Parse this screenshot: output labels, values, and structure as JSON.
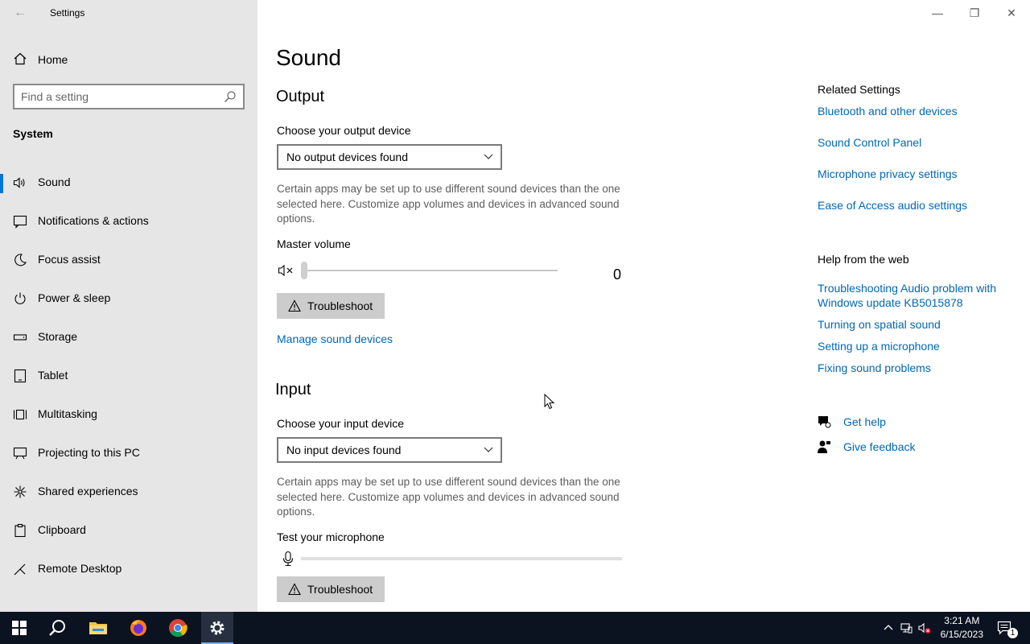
{
  "window": {
    "title": "Settings",
    "back_glyph": "←",
    "controls": {
      "minimize": "—",
      "maximize": "❐",
      "close": "✕"
    }
  },
  "sidebar": {
    "home_label": "Home",
    "search_placeholder": "Find a setting",
    "section": "System",
    "items": [
      {
        "label": "Sound",
        "icon": "speaker-icon",
        "active": true
      },
      {
        "label": "Notifications & actions",
        "icon": "notification-icon"
      },
      {
        "label": "Focus assist",
        "icon": "moon-icon"
      },
      {
        "label": "Power & sleep",
        "icon": "power-icon"
      },
      {
        "label": "Storage",
        "icon": "storage-icon"
      },
      {
        "label": "Tablet",
        "icon": "tablet-icon"
      },
      {
        "label": "Multitasking",
        "icon": "multitasking-icon"
      },
      {
        "label": "Projecting to this PC",
        "icon": "projector-icon"
      },
      {
        "label": "Shared experiences",
        "icon": "share-icon"
      },
      {
        "label": "Clipboard",
        "icon": "clipboard-icon"
      },
      {
        "label": "Remote Desktop",
        "icon": "remote-icon"
      }
    ]
  },
  "main": {
    "title": "Sound",
    "output": {
      "heading": "Output",
      "device_label": "Choose your output device",
      "device_value": "No output devices found",
      "description": "Certain apps may be set up to use different sound devices than the one selected here. Customize app volumes and devices in advanced sound options.",
      "volume_label": "Master volume",
      "volume_value": "0",
      "volume_level": 0,
      "troubleshoot_label": "Troubleshoot",
      "manage_link": "Manage sound devices"
    },
    "input": {
      "heading": "Input",
      "device_label": "Choose your input device",
      "device_value": "No input devices found",
      "description": "Certain apps may be set up to use different sound devices than the one selected here. Customize app volumes and devices in advanced sound options.",
      "test_label": "Test your microphone",
      "troubleshoot_label": "Troubleshoot"
    }
  },
  "related": {
    "heading": "Related Settings",
    "links": [
      "Bluetooth and other devices",
      "Sound Control Panel",
      "Microphone privacy settings",
      "Ease of Access audio settings"
    ],
    "help_heading": "Help from the web",
    "help_links": [
      "Troubleshooting Audio problem with Windows update KB5015878",
      "Turning on spatial sound",
      "Setting up a microphone",
      "Fixing sound problems"
    ],
    "get_help": "Get help",
    "give_feedback": "Give feedback"
  },
  "taskbar": {
    "time": "3:21 AM",
    "date": "6/15/2023",
    "notification_count": "1",
    "accent": "#0078d7"
  }
}
